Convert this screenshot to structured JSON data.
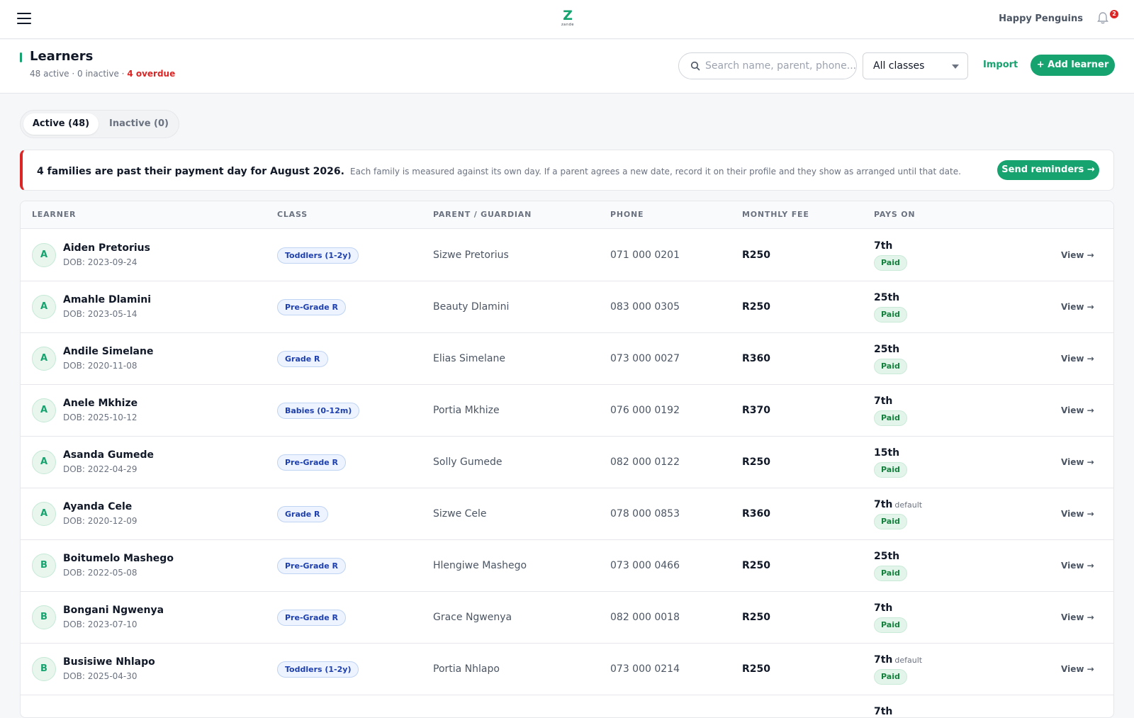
{
  "topbar": {
    "logo_letter": "Z",
    "logo_word": "zande",
    "school_name": "Happy Penguins",
    "notification_count": "2"
  },
  "header": {
    "title": "Learners",
    "subtitle_counts": "48 active · 0 inactive · ",
    "subtitle_overdue": "4 overdue",
    "search_placeholder": "Search name, parent, phone...",
    "class_filter": "All classes",
    "import_label": "Import",
    "add_label": "+ Add learner"
  },
  "tabs": {
    "active": "Active (48)",
    "inactive": "Inactive (0)"
  },
  "banner": {
    "strong": "4 families are past their payment day for August 2026.",
    "detail": "Each family is measured against its own day. If a parent agrees a new date, record it on their profile and they show as arranged until that date.",
    "button": "Send reminders →"
  },
  "table": {
    "headers": {
      "learner": "LEARNER",
      "class": "CLASS",
      "parent": "PARENT / GUARDIAN",
      "phone": "PHONE",
      "fee": "MONTHLY FEE",
      "pays_on": "PAYS ON"
    },
    "rows": [
      {
        "initial": "A",
        "name": "Aiden Pretorius",
        "dob": "DOB: 2023-09-24",
        "class": "Toddlers (1-2y)",
        "parent": "Sizwe Pretorius",
        "phone": "071 000 0201",
        "fee": "R250",
        "pays_day": "7th",
        "pays_default": "",
        "status": "Paid",
        "view": "View →"
      },
      {
        "initial": "A",
        "name": "Amahle Dlamini",
        "dob": "DOB: 2023-05-14",
        "class": "Pre-Grade R",
        "parent": "Beauty Dlamini",
        "phone": "083 000 0305",
        "fee": "R250",
        "pays_day": "25th",
        "pays_default": "",
        "status": "Paid",
        "view": "View →"
      },
      {
        "initial": "A",
        "name": "Andile Simelane",
        "dob": "DOB: 2020-11-08",
        "class": "Grade R",
        "parent": "Elias Simelane",
        "phone": "073 000 0027",
        "fee": "R360",
        "pays_day": "25th",
        "pays_default": "",
        "status": "Paid",
        "view": "View →"
      },
      {
        "initial": "A",
        "name": "Anele Mkhize",
        "dob": "DOB: 2025-10-12",
        "class": "Babies (0-12m)",
        "parent": "Portia Mkhize",
        "phone": "076 000 0192",
        "fee": "R370",
        "pays_day": "7th",
        "pays_default": "",
        "status": "Paid",
        "view": "View →"
      },
      {
        "initial": "A",
        "name": "Asanda Gumede",
        "dob": "DOB: 2022-04-29",
        "class": "Pre-Grade R",
        "parent": "Solly Gumede",
        "phone": "082 000 0122",
        "fee": "R250",
        "pays_day": "15th",
        "pays_default": "",
        "status": "Paid",
        "view": "View →"
      },
      {
        "initial": "A",
        "name": "Ayanda Cele",
        "dob": "DOB: 2020-12-09",
        "class": "Grade R",
        "parent": "Sizwe Cele",
        "phone": "078 000 0853",
        "fee": "R360",
        "pays_day": "7th",
        "pays_default": "default",
        "status": "Paid",
        "view": "View →"
      },
      {
        "initial": "B",
        "name": "Boitumelo Mashego",
        "dob": "DOB: 2022-05-08",
        "class": "Pre-Grade R",
        "parent": "Hlengiwe Mashego",
        "phone": "073 000 0466",
        "fee": "R250",
        "pays_day": "25th",
        "pays_default": "",
        "status": "Paid",
        "view": "View →"
      },
      {
        "initial": "B",
        "name": "Bongani Ngwenya",
        "dob": "DOB: 2023-07-10",
        "class": "Pre-Grade R",
        "parent": "Grace Ngwenya",
        "phone": "082 000 0018",
        "fee": "R250",
        "pays_day": "7th",
        "pays_default": "",
        "status": "Paid",
        "view": "View →"
      },
      {
        "initial": "B",
        "name": "Busisiwe Nhlapo",
        "dob": "DOB: 2025-04-30",
        "class": "Toddlers (1-2y)",
        "parent": "Portia Nhlapo",
        "phone": "073 000 0214",
        "fee": "R250",
        "pays_day": "7th",
        "pays_default": "default",
        "status": "Paid",
        "view": "View →"
      },
      {
        "initial": "",
        "name": "",
        "dob": "",
        "class": "",
        "parent": "",
        "phone": "",
        "fee": "",
        "pays_day": "7th",
        "pays_default": "",
        "status": "",
        "view": ""
      }
    ]
  },
  "colors": {
    "brand": "#16a36f",
    "danger": "#dc2626",
    "class_badge": "#1e40af",
    "paid": "#15803d"
  },
  "icons": [
    "menu-icon",
    "logo",
    "bell-icon",
    "search-icon",
    "chevron-down-icon"
  ]
}
